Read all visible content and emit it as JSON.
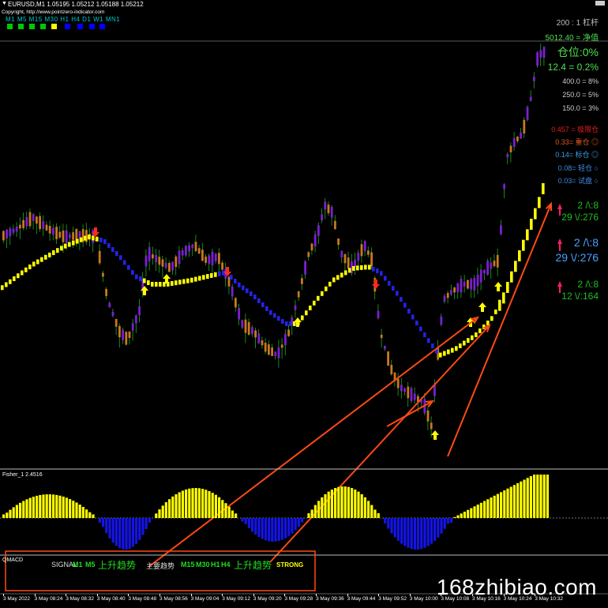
{
  "header": {
    "symbol_line": "EURUSD,M1  1.05195 1.05212 1.05188 1.05212",
    "copyright": "Copyright, http://www.pointzero-indicator.com",
    "timeframes": "M1  M5  M15 M30 H1   H4   D1   W1  MN1",
    "timeframe_colors": [
      "#00c800",
      "#00c800",
      "#00c800",
      "#00c800",
      "#ffff00",
      "#0000ff",
      "#0000ff",
      "#0000ff",
      "#0000ff"
    ]
  },
  "right_panel": {
    "leverage": "200 : 1 杠杆",
    "equity": "5012.40 = 净值",
    "position": "仓位:0%",
    "lots": "12.4 = 0.2%",
    "r1": "400.0 = 8%",
    "r2": "250.0 = 5%",
    "r3": "150.0 = 3%",
    "risk1": "0.457 = 极限仓",
    "risk2": "0.33= 重仓 ◎",
    "risk3": "0.14= 标仓 ◎",
    "risk4": "0.08= 轻仓 ○",
    "risk5": "0.03= 试盘 ○",
    "sig1_a": "2 /\\:8",
    "sig1_b": "29 \\/:276",
    "sig2_a": "2 /\\:8",
    "sig2_b": "29 \\/:276",
    "sig3_a": "2 /\\:8",
    "sig3_b": "12 \\/:164"
  },
  "indicators": {
    "fisher_title": "Fisher_1 2.4516",
    "macd_title": "QMACD"
  },
  "signal_bar": {
    "signal": "SIGNAL",
    "m1": "M1",
    "m5": "M5",
    "up1": "上升趋势",
    "main": "主要趋势",
    "m15": "M15",
    "m30": "M30",
    "h1": "H1",
    "h4": "H4",
    "up2": "上升趋势",
    "strong": "STRONG"
  },
  "time_axis": [
    "3 May 2022",
    "3 May 08:24",
    "3 May 08:32",
    "3 May 08:40",
    "3 May 08:48",
    "3 May 08:56",
    "3 May 09:04",
    "3 May 09:12",
    "3 May 09:20",
    "3 May 09:28",
    "3 May 09:36",
    "3 May 09:44",
    "3 May 09:52",
    "3 May 10:00",
    "3 May 10:08",
    "3 May 10:16",
    "3 May 10:24",
    "3 May 10:32"
  ],
  "watermark": "168zhibiao.com",
  "colors": {
    "bull_candle": "#7a1fd1",
    "bear_candle": "#c8781e",
    "wick": "#1faa1f",
    "trend_up": "#ffff00",
    "trend_down": "#2323e6",
    "annot": "#ff4a14",
    "fisher_pos": "#ffff00",
    "fisher_neg": "#1414e6"
  }
}
